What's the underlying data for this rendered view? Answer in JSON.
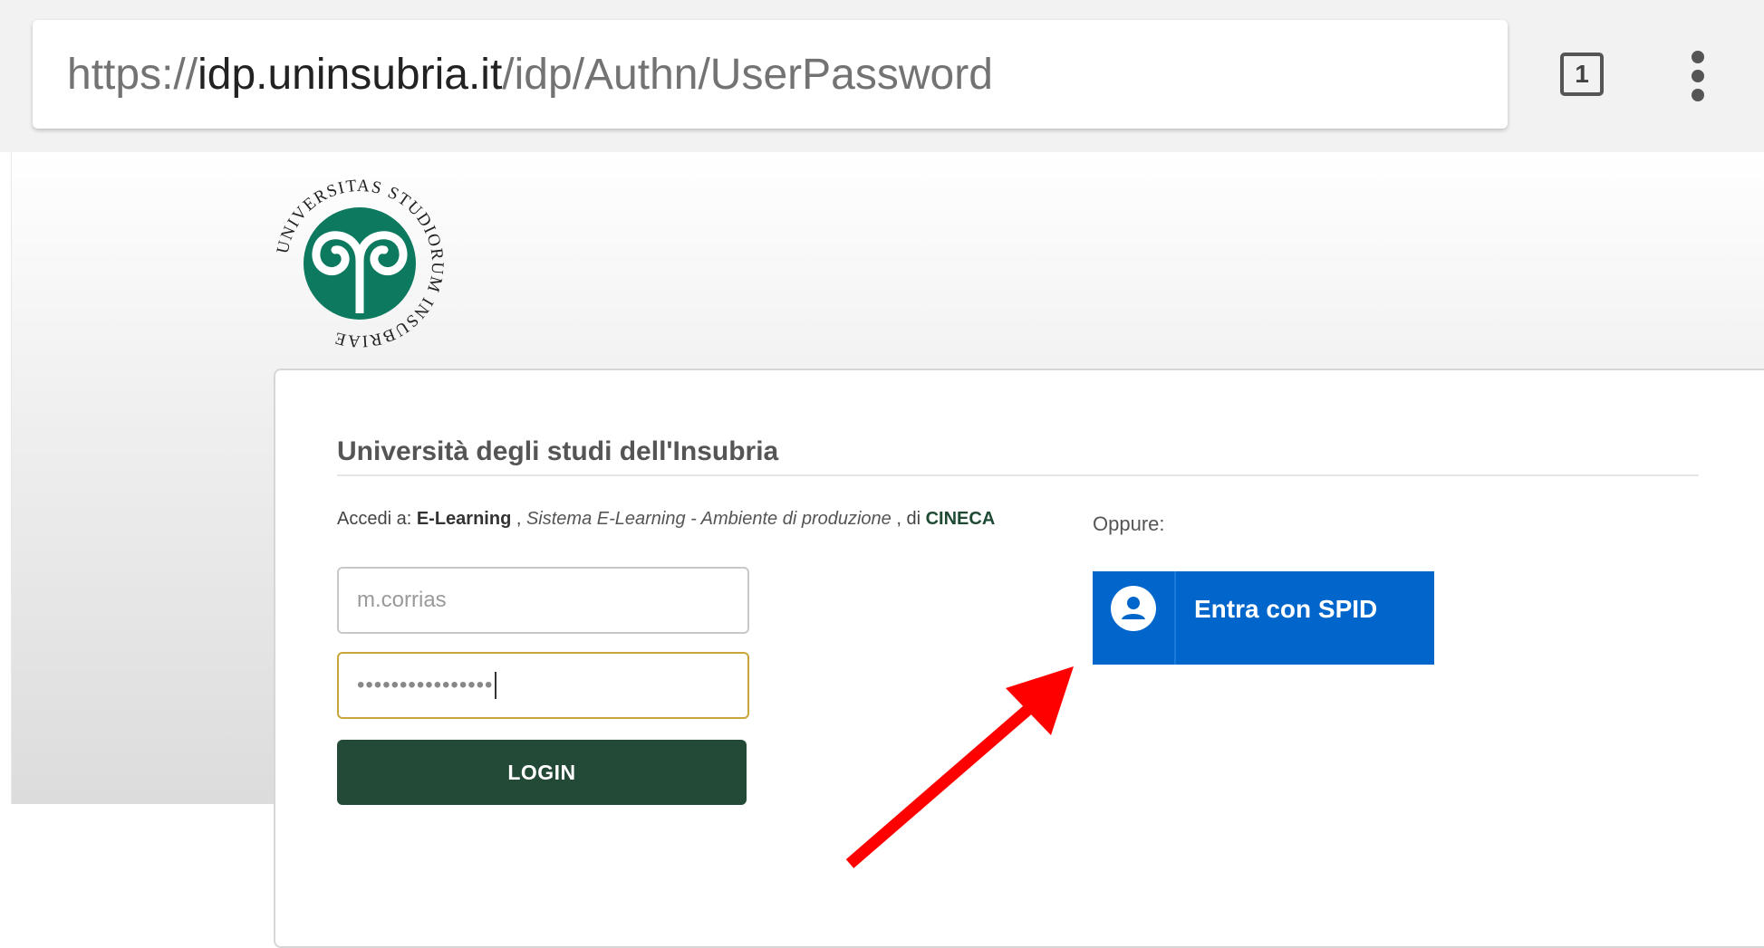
{
  "browser": {
    "url_scheme": "https://",
    "url_host": "idp.uninsubria.it",
    "url_path": "/idp/Authn/UserPassword",
    "tab_count": "1"
  },
  "logo": {
    "seal_text": "UNIVERSITAS STUDIORUM INSUBRIAE",
    "color": "#0d7a5f"
  },
  "card": {
    "title": "Università degli studi dell'Insubria",
    "accedi_prefix": "Accedi a:",
    "service_name": "E-Learning",
    "separator": ",",
    "service_desc": "Sistema E-Learning - Ambiente di produzione",
    "separator2": ", di",
    "provider": "CINECA"
  },
  "form": {
    "username_value": "m.corrias",
    "password_masked": "••••••••••••••••",
    "login_label": "LOGIN"
  },
  "alt_login": {
    "oppure": "Oppure:",
    "spid_label": "Entra con SPID"
  },
  "colors": {
    "login_button": "#234a36",
    "spid_button": "#0066cc",
    "annotation_arrow": "#ff0000"
  }
}
